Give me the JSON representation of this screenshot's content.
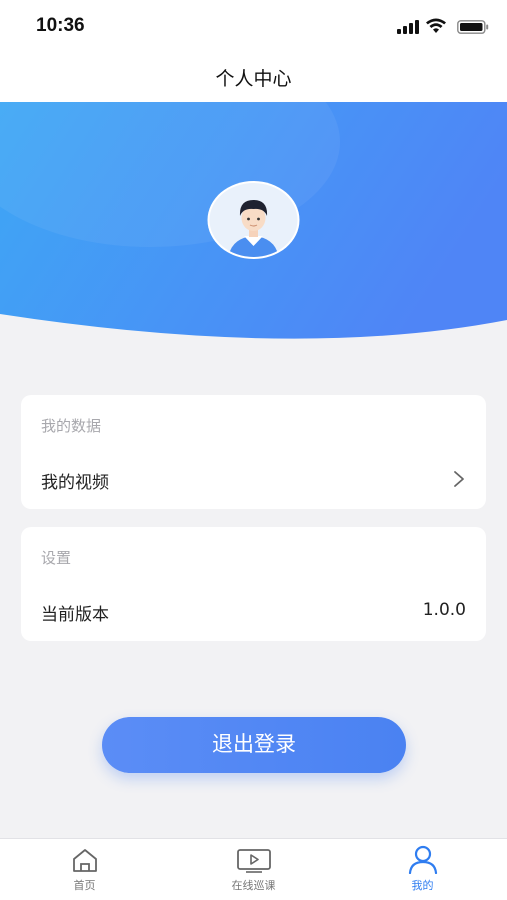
{
  "status_bar": {
    "time": "10:36"
  },
  "header": {
    "title": "个人中心"
  },
  "colors": {
    "accent": "#4a82f2",
    "hero_start": "#3ea7f5",
    "hero_end": "#4f85f6",
    "tab_active": "#2f7df0"
  },
  "profile": {
    "avatar_icon": "boy-avatar-icon"
  },
  "sections": [
    {
      "title": "我的数据",
      "row_label": "我的视频",
      "row_icon": "chevron-right-icon"
    },
    {
      "title": "设置",
      "row_label": "当前版本",
      "row_value": "1.0.0"
    }
  ],
  "logout_label": "退出登录",
  "tabs": [
    {
      "label": "首页",
      "icon": "home-icon"
    },
    {
      "label": "在线巡课",
      "icon": "video-play-icon"
    },
    {
      "label": "我的",
      "icon": "user-icon",
      "active": true
    }
  ]
}
